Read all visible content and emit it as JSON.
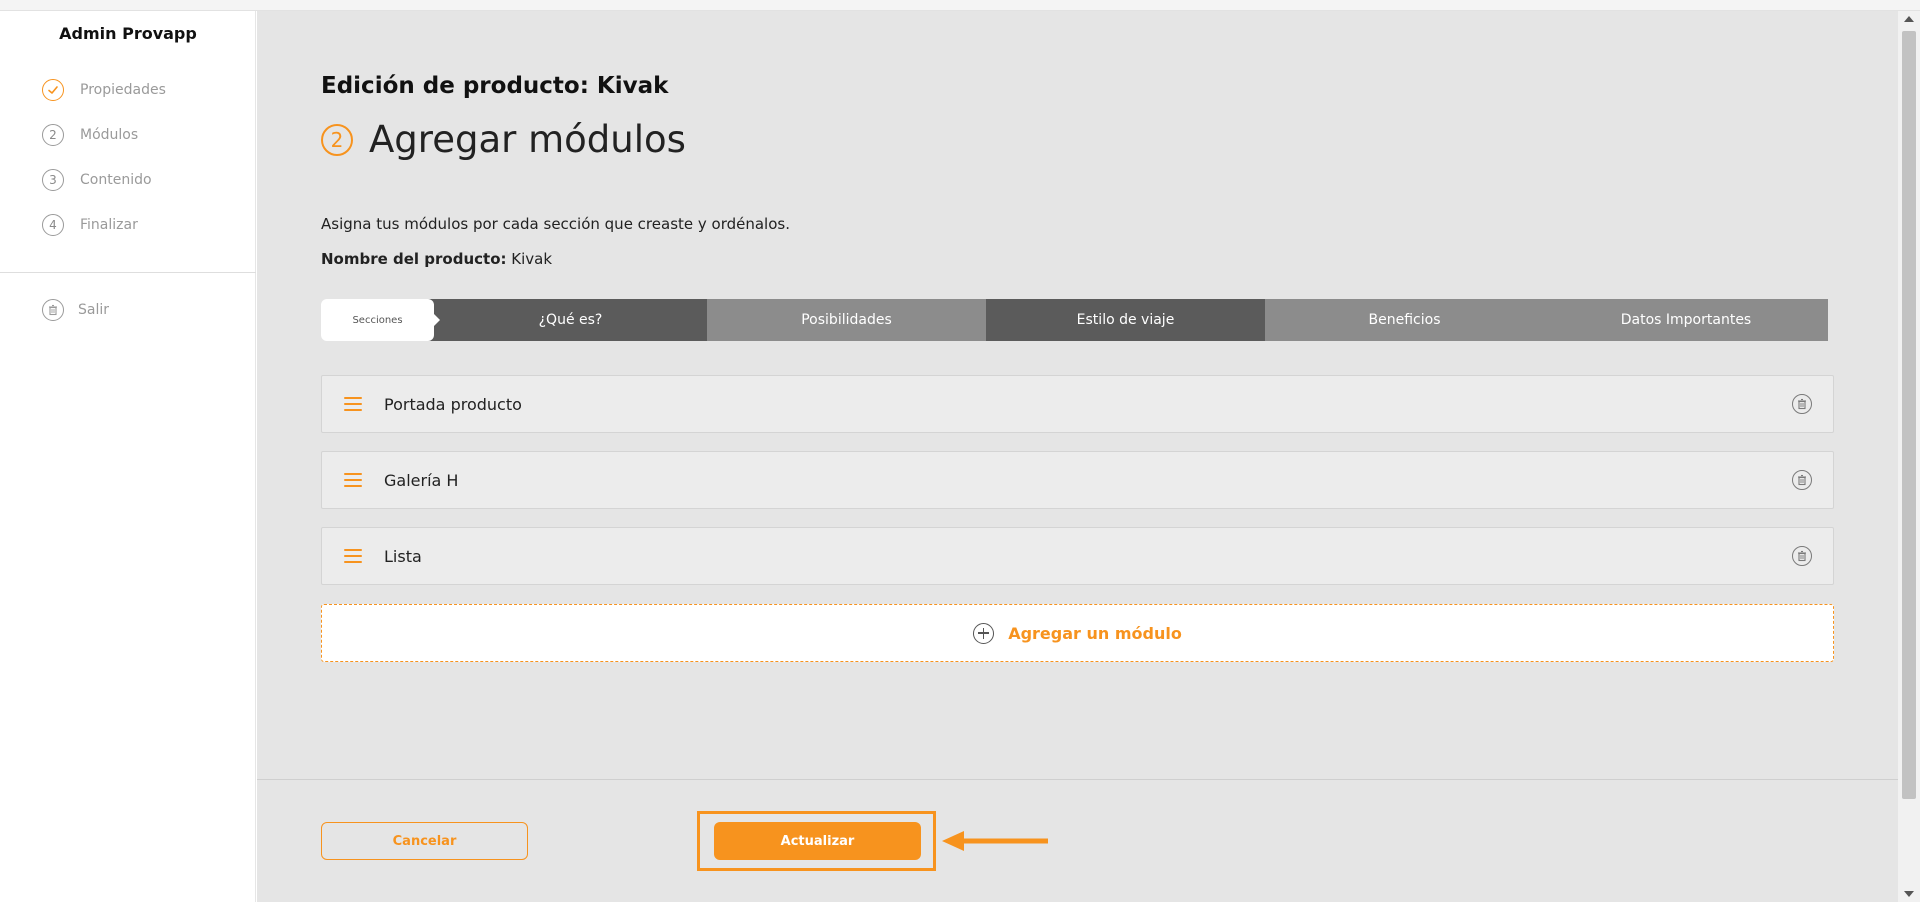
{
  "app": {
    "brand": "Admin Provapp"
  },
  "sidebar": {
    "steps": [
      {
        "number": "",
        "label": "Propiedades",
        "status": "done"
      },
      {
        "number": "2",
        "label": "Módulos",
        "status": "pending"
      },
      {
        "number": "3",
        "label": "Contenido",
        "status": "pending"
      },
      {
        "number": "4",
        "label": "Finalizar",
        "status": "pending"
      }
    ],
    "logout_label": "Salir"
  },
  "main": {
    "heading": "Edición de producto: Kivak",
    "step_number": "2",
    "step_title": "Agregar módulos",
    "instructions": "Asigna tus módulos por cada sección que creaste y ordénalos.",
    "product_name_label": "Nombre del producto:",
    "product_name_value": "Kivak",
    "tabs": [
      {
        "label": "Secciones",
        "style": "active"
      },
      {
        "label": "¿Qué es?",
        "style": "dark"
      },
      {
        "label": "Posibilidades",
        "style": "mid"
      },
      {
        "label": "Estilo de viaje",
        "style": "dark"
      },
      {
        "label": "Beneficios",
        "style": "mid"
      },
      {
        "label": "Datos Importantes",
        "style": "mid"
      }
    ],
    "modules": [
      {
        "label": "Portada producto"
      },
      {
        "label": "Galería H"
      },
      {
        "label": "Lista"
      }
    ],
    "add_module_label": "Agregar un módulo"
  },
  "footer": {
    "cancel_label": "Cancelar",
    "update_label": "Actualizar"
  },
  "colors": {
    "accent": "#f7931e",
    "background": "#e5e5e5",
    "tab_dark": "#5b5b5b",
    "tab_mid": "#8c8c8c"
  },
  "icons": {
    "step_done": "check-icon",
    "logout": "trash-icon",
    "module_drag": "drag-handle-icon",
    "module_delete": "trash-icon",
    "add": "plus-circle-icon",
    "annotation": "arrow-left-icon"
  }
}
